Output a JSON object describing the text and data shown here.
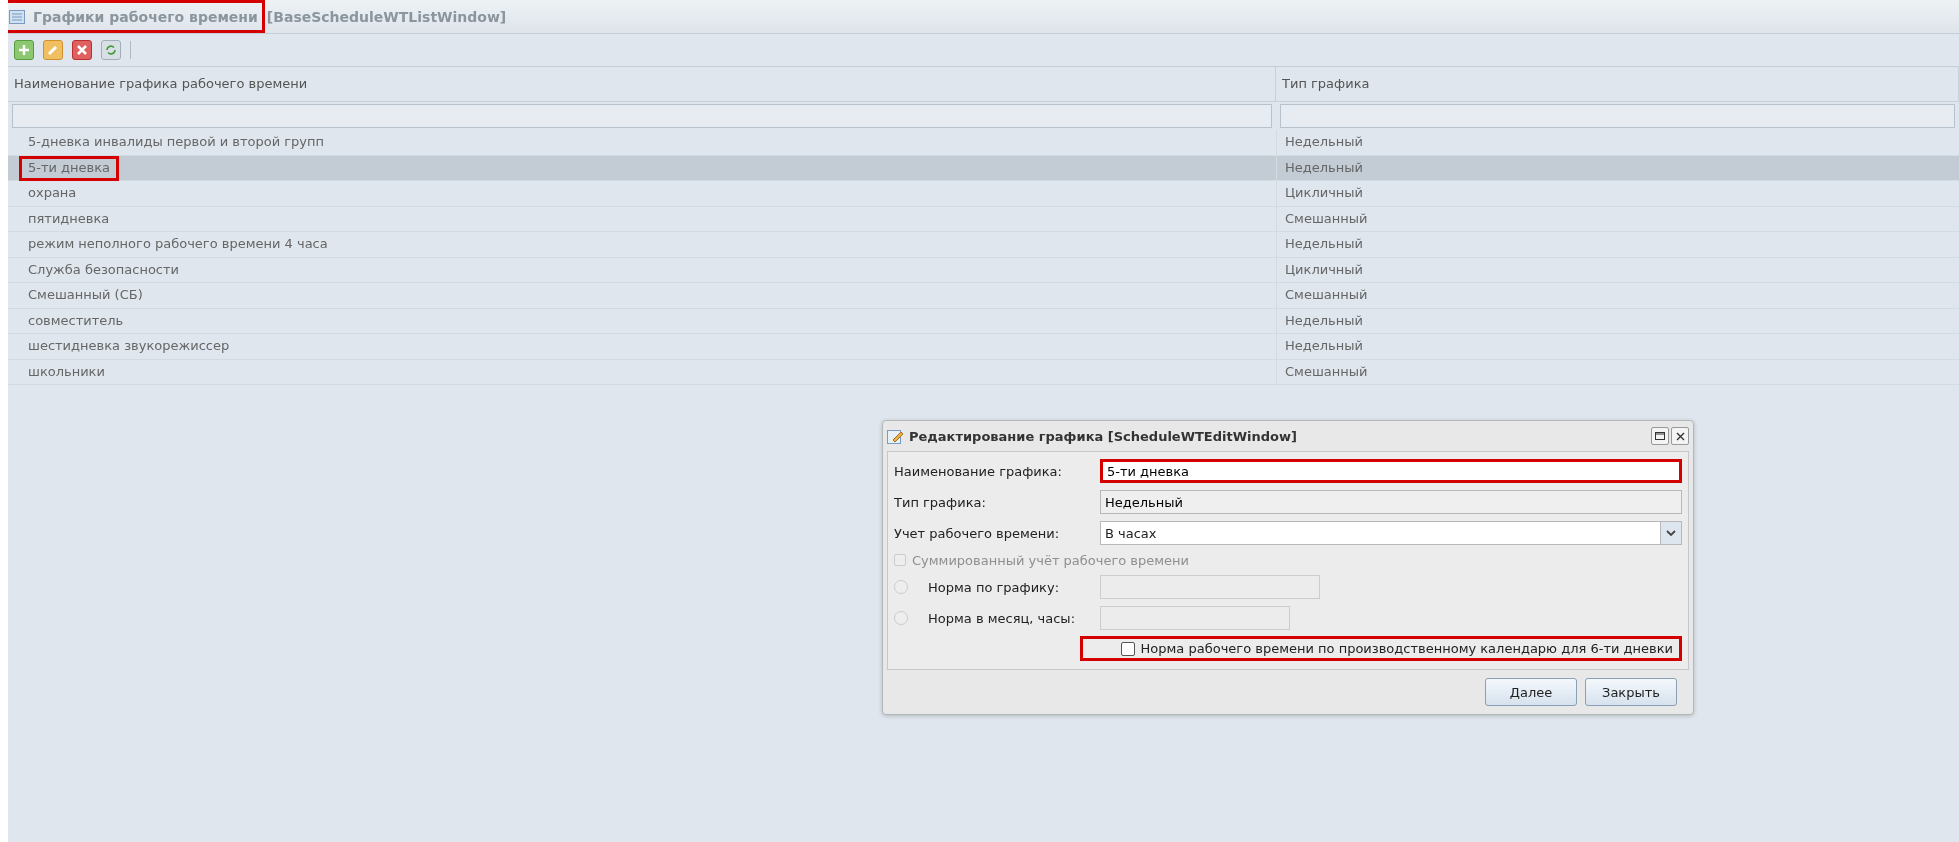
{
  "window": {
    "title": "Графики рабочего времени",
    "class_name": "[BaseScheduleWTListWindow]",
    "highlighted": true
  },
  "toolbar": [
    {
      "kind": "add"
    },
    {
      "kind": "edit"
    },
    {
      "kind": "delete"
    },
    {
      "kind": "refresh"
    }
  ],
  "table": {
    "columns": [
      "Наименование графика рабочего времени",
      "Тип графика"
    ],
    "rows": [
      {
        "name": "5-дневка инвалиды первой и второй групп",
        "type": "Недельный",
        "selected": false,
        "highlighted": false
      },
      {
        "name": "5-ти дневка",
        "type": "Недельный",
        "selected": true,
        "highlighted": true
      },
      {
        "name": "охрана",
        "type": "Цикличный",
        "selected": false,
        "highlighted": false
      },
      {
        "name": "пятидневка",
        "type": "Смешанный",
        "selected": false,
        "highlighted": false
      },
      {
        "name": "режим неполного рабочего времени 4 часа",
        "type": "Недельный",
        "selected": false,
        "highlighted": false
      },
      {
        "name": "Служба безопасности",
        "type": "Цикличный",
        "selected": false,
        "highlighted": false
      },
      {
        "name": "Смешанный (СБ)",
        "type": "Смешанный",
        "selected": false,
        "highlighted": false
      },
      {
        "name": "совместитель",
        "type": "Недельный",
        "selected": false,
        "highlighted": false
      },
      {
        "name": "шестидневка звукорежиссер",
        "type": "Недельный",
        "selected": false,
        "highlighted": false
      },
      {
        "name": "школьники",
        "type": "Смешанный",
        "selected": false,
        "highlighted": false
      }
    ]
  },
  "dialog": {
    "title": "Редактирование графика [ScheduleWTEditWindow]",
    "name_field": {
      "label": "Наименование графика:",
      "value": "5-ти дневка",
      "highlighted": true
    },
    "type_field": {
      "label": "Тип графика:",
      "value": "Недельный"
    },
    "accounting_field": {
      "label": "Учет рабочего времени:",
      "value": "В часах"
    },
    "summed_checkbox": {
      "label": "Суммированный учёт рабочего времени",
      "checked": false,
      "disabled": true
    },
    "norm_options": [
      {
        "label": "Норма по графику:",
        "selected": false,
        "disabled": true
      },
      {
        "label": "Норма в месяц, часы:",
        "selected": false,
        "disabled": true
      }
    ],
    "calendar_checkbox": {
      "label": "Норма рабочего времени по производственному календарю для 6-ти дневки",
      "checked": false,
      "highlighted": true
    },
    "buttons": [
      "Далее",
      "Закрыть"
    ]
  }
}
